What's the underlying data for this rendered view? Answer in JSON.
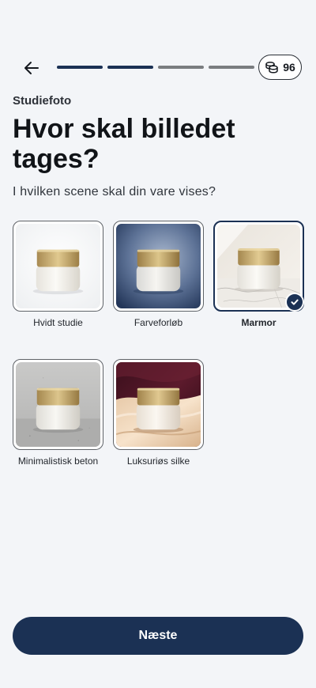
{
  "header": {
    "back_icon": "arrow-left-icon",
    "progress": {
      "total_steps": 4,
      "completed_steps": 2
    },
    "credits": {
      "icon": "coins-icon",
      "count": "96"
    }
  },
  "page": {
    "eyebrow": "Studiefoto",
    "title": "Hvor skal billedet tages?",
    "subtitle": "I hvilken scene skal din vare vises?"
  },
  "options": [
    {
      "label": "Hvidt studie",
      "selected": false
    },
    {
      "label": "Farveforløb",
      "selected": false
    },
    {
      "label": "Marmor",
      "selected": true
    },
    {
      "label": "Minimalistisk beton",
      "selected": false
    },
    {
      "label": "Luksuriøs silke",
      "selected": false
    }
  ],
  "footer": {
    "next_label": "Næste"
  },
  "colors": {
    "primary": "#1b3154",
    "background": "#f3f5f8",
    "progress_inactive": "#7a7d80"
  }
}
